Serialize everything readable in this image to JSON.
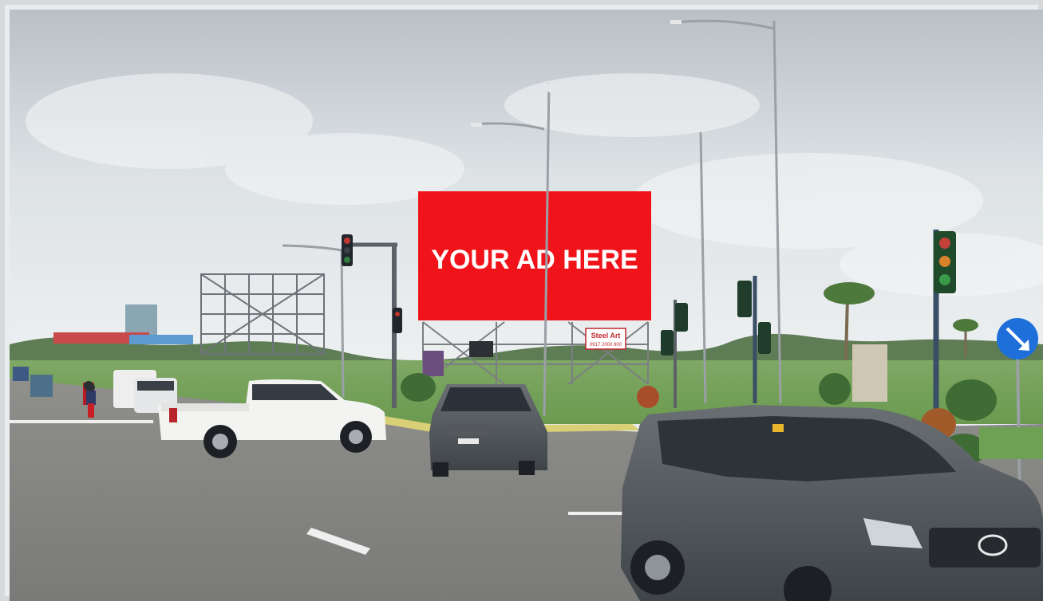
{
  "billboard": {
    "text": "YOUR AD HERE",
    "color": "#f0141a"
  },
  "small_sign": {
    "text": "Steel Art",
    "subtext": "0917 2000 800"
  },
  "road_sign": {
    "icon": "arrow-down-right-icon",
    "color": "#1e6fd9"
  }
}
